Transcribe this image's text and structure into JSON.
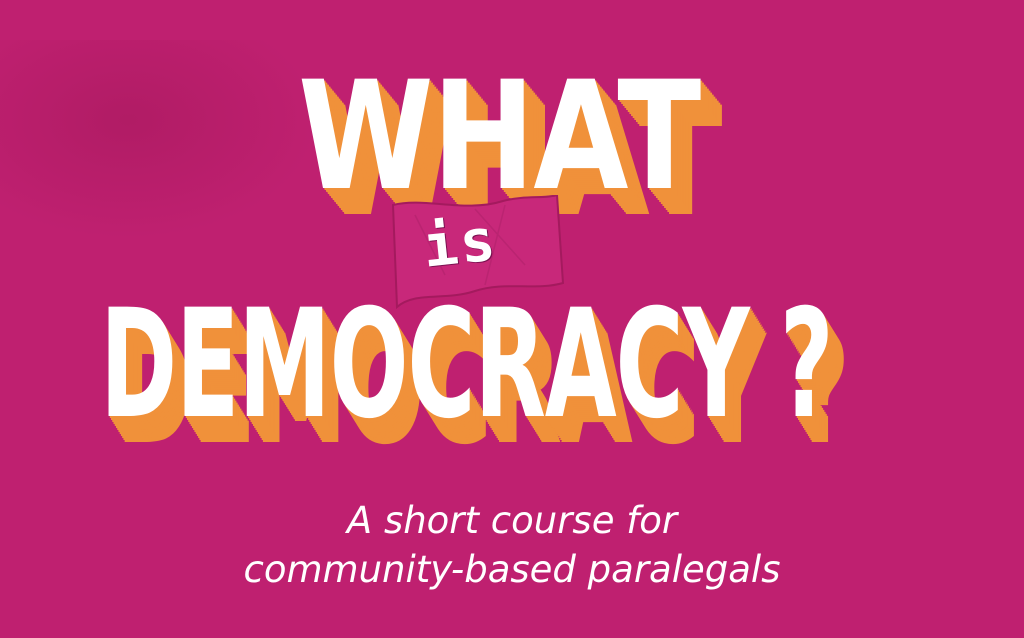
{
  "title": {
    "line1": "WHAT",
    "connector": "is",
    "line2": "DEMOCRACY ?"
  },
  "subtitle": {
    "line1": "A short course for",
    "line2": "community-based paralegals"
  },
  "colors": {
    "background": "#bf2070",
    "title_fill": "#ffffff",
    "title_shadow": "#f0913a",
    "flag": "#c8287a",
    "subtitle": "#ffffff"
  }
}
